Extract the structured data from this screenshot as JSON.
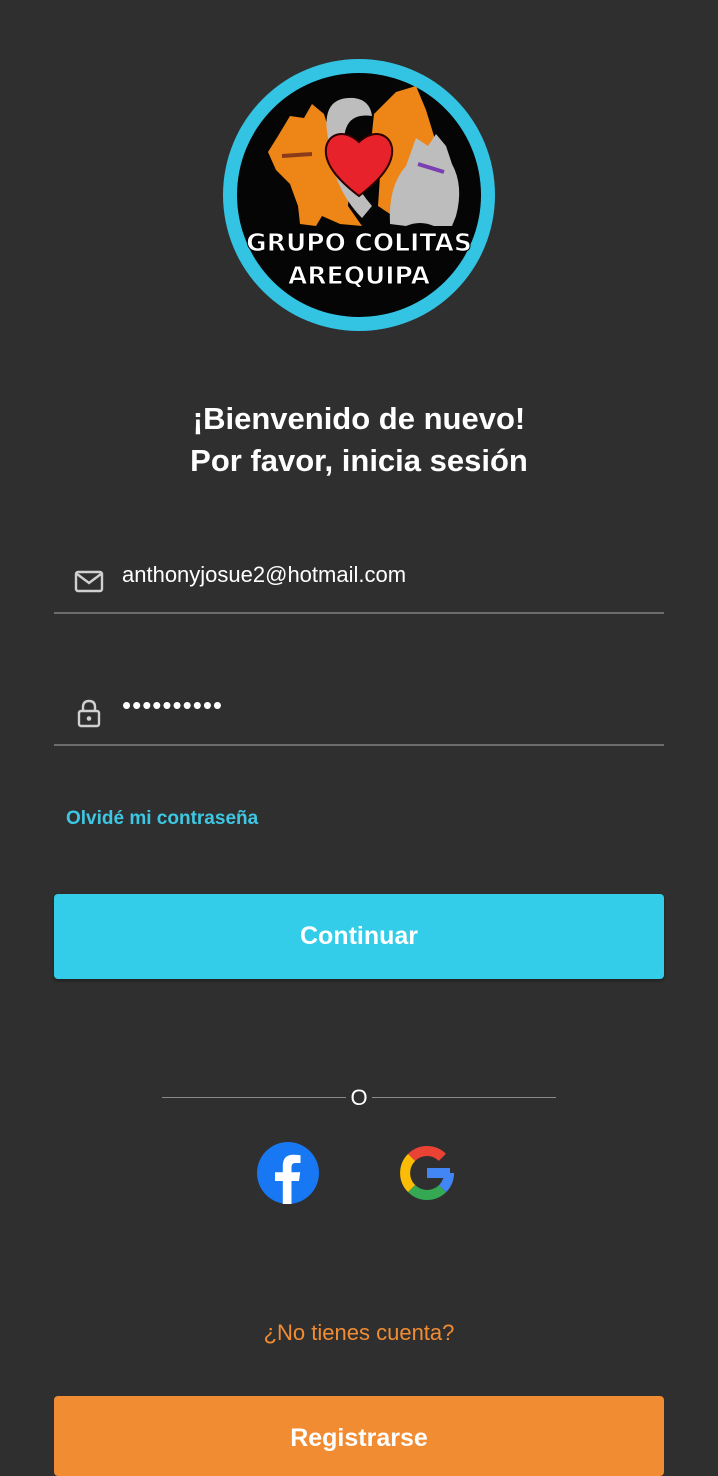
{
  "logo": {
    "line1": "GRUPO COLITAS",
    "line2": "AREQUIPA",
    "ring_color": "#33c3e3",
    "icon": "cat-dog-heart-logo"
  },
  "welcome": {
    "line1": "¡Bienvenido de nuevo!",
    "line2": "Por favor, inicia sesión"
  },
  "email": {
    "icon": "mail-icon",
    "value": "anthonyjosue2@hotmail.com"
  },
  "password": {
    "icon": "lock-icon",
    "value": "••••••••••"
  },
  "forgot_label": "Olvidé mi contraseña",
  "continue_label": "Continuar",
  "or_label": "O",
  "social": {
    "facebook_icon": "facebook-icon",
    "google_icon": "google-icon"
  },
  "signup_question": "¿No tienes cuenta?",
  "register_label": "Registrarse",
  "colors": {
    "background": "#2f2f2f",
    "primary": "#33cde9",
    "accent": "#f28c32",
    "link": "#3ec7e3"
  }
}
